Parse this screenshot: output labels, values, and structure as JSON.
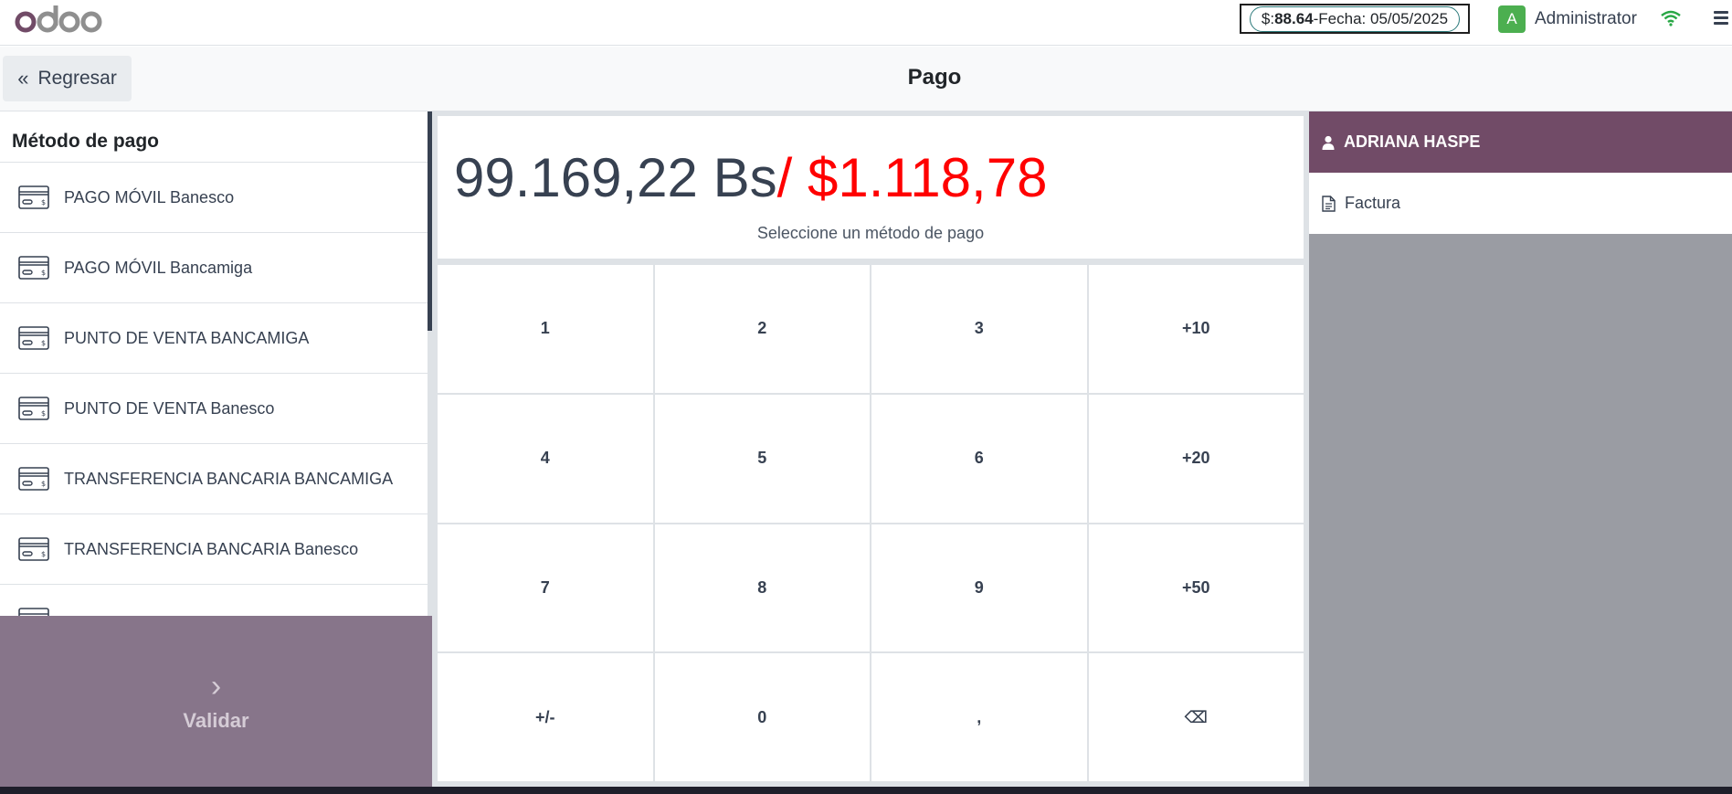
{
  "navbar": {
    "brand": "odoo",
    "rate_prefix": "$:",
    "rate_value": "88.64",
    "rate_suffix": "-Fecha: 05/05/2025",
    "user_initial": "A",
    "user_name": "Administrator",
    "icons": [
      "wifi-icon",
      "hamburger-menu-icon"
    ]
  },
  "controlbar": {
    "back_label": "Regresar",
    "title": "Pago"
  },
  "payment_methods": {
    "heading": "Método de pago",
    "items": [
      {
        "label": "PAGO MÓVIL Banesco"
      },
      {
        "label": "PAGO MÓVIL Bancamiga"
      },
      {
        "label": "PUNTO DE VENTA BANCAMIGA"
      },
      {
        "label": "PUNTO DE VENTA Banesco"
      },
      {
        "label": "TRANSFERENCIA BANCARIA BANCAMIGA"
      },
      {
        "label": "TRANSFERENCIA BANCARIA Banesco"
      },
      {
        "label": ""
      }
    ],
    "validate_label": "Validar"
  },
  "amount": {
    "bs": "99.169,22 Bs",
    "usd": "/ $1.118,78",
    "hint": "Seleccione un método de pago"
  },
  "numpad": {
    "keys": [
      "1",
      "2",
      "3",
      "+10",
      "4",
      "5",
      "6",
      "+20",
      "7",
      "8",
      "9",
      "+50",
      "+/-",
      "0",
      ",",
      "⌫"
    ]
  },
  "customer": {
    "name": "ADRIANA HASPE",
    "invoice_label": "Factura"
  },
  "colors": {
    "brand_purple": "#714b67",
    "usd_red": "#ff0000",
    "validate_bg": "#87758a"
  }
}
